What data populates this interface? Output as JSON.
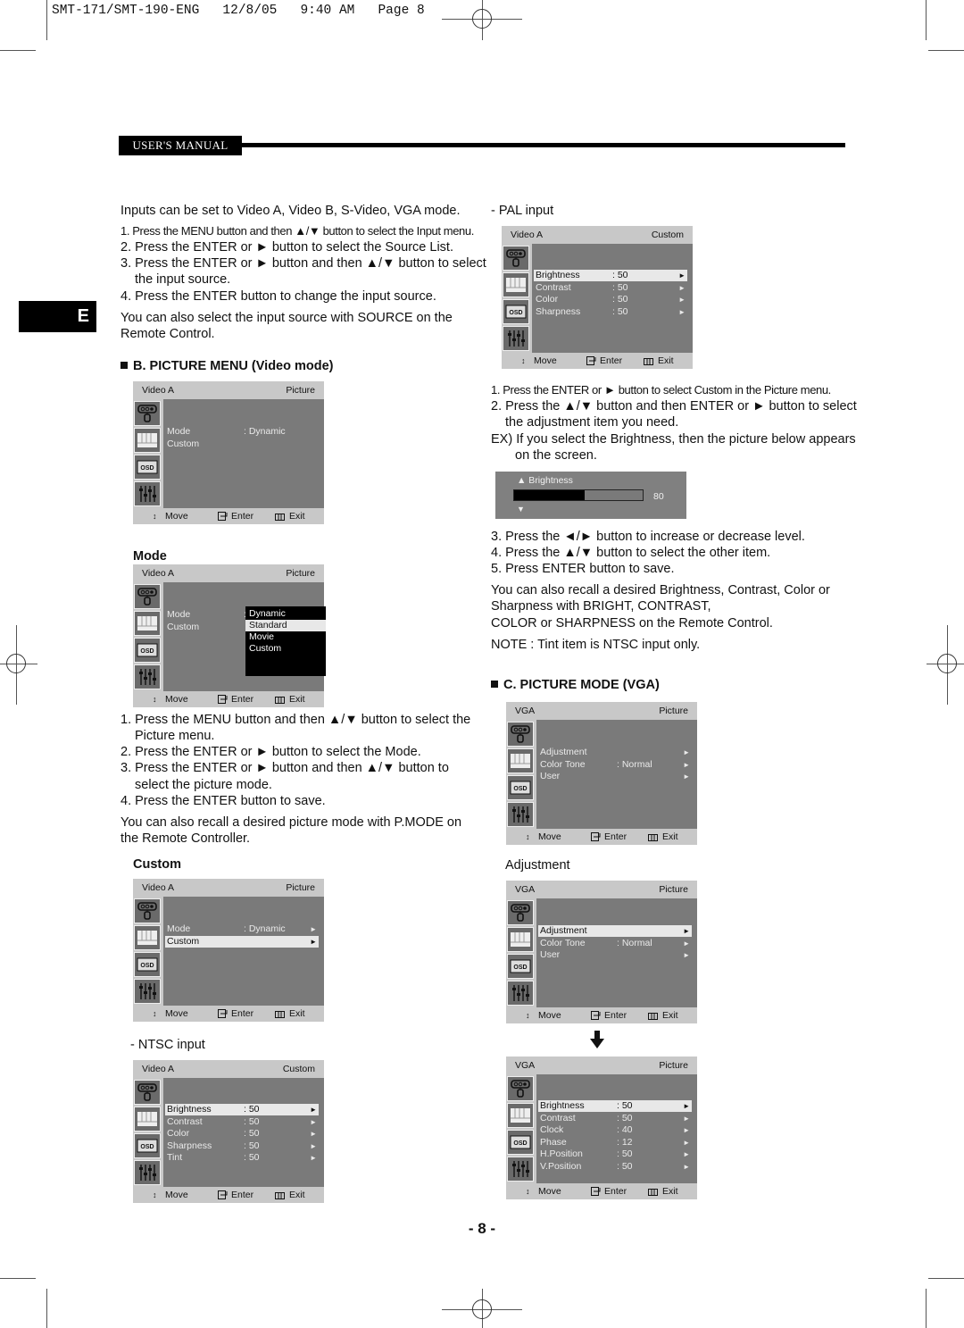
{
  "print_header": "SMT-171/SMT-190-ENG   12/8/05   9:40 AM   Page 8",
  "badge": "USER'S MANUAL",
  "language_tab": "E",
  "page_number": "- 8 -",
  "left": {
    "intro": "Inputs can be set to Video A, Video B, S-Video, VGA mode.",
    "input_steps": [
      "1. Press the MENU button and then ▲/▼ button to select the Input menu.",
      "2. Press the ENTER or ► button to select the Source List.",
      "3. Press the ENTER or ► button and then ▲/▼ button to select",
      "the input source.",
      "4. Press the ENTER button to change the input source."
    ],
    "source_note": [
      "You can also select the input source with SOURCE on the",
      "Remote Control."
    ],
    "section_b": "B. PICTURE MENU (Video mode)",
    "mode_heading": "Mode",
    "mode_steps": [
      "1. Press the MENU button and then ▲/▼ button to select the",
      "Picture menu.",
      "2. Press the ENTER or ► button to select the Mode.",
      "3. Press the ENTER or ► button and then ▲/▼ button to",
      "select the picture mode.",
      "4. Press the ENTER button to save."
    ],
    "pmode_note": [
      "You can also recall a desired picture mode with P.MODE on",
      "the Remote Controller."
    ],
    "custom_heading": "Custom",
    "ntsc_label": "-  NTSC input"
  },
  "right": {
    "pal_label": "- PAL input",
    "custom_steps": [
      "1. Press the ENTER or ► button to select Custom in the Picture menu.",
      "2. Press the ▲/▼ button and then ENTER or ► button to select",
      "the adjustment item you need.",
      "EX) If you select the Brightness, then the picture below appears",
      "on the screen."
    ],
    "brightness_osd": {
      "label": "▲ Brightness",
      "value": "80",
      "level_percent": 80,
      "down": "▼"
    },
    "level_steps": [
      "3. Press the ◄/► button to increase or decrease level.",
      "4. Press the ▲/▼ button to select the other item.",
      "5. Press ENTER button to save."
    ],
    "recall_note": [
      "You can also recall a desired Brightness, Contrast, Color or",
      "Sharpness with BRIGHT, CONTRAST,",
      "COLOR or SHARPNESS on the Remote Control."
    ],
    "tint_note": "NOTE : Tint item is NTSC input only.",
    "section_c": "C. PICTURE MODE (VGA)",
    "adjustment_heading": "Adjustment"
  },
  "osd_footer": {
    "move": "Move",
    "enter": "Enter",
    "exit": "Exit"
  },
  "osd_menus": {
    "picture1": {
      "source": "Video A",
      "title": "Picture",
      "rows": [
        {
          "name": "Mode",
          "value": ": Dynamic",
          "arrow": ""
        },
        {
          "name": "Custom",
          "value": "",
          "arrow": ""
        }
      ]
    },
    "mode": {
      "source": "Video A",
      "title": "Picture",
      "rows": [
        {
          "name": "Mode",
          "value": ":",
          "arrow": ""
        },
        {
          "name": "Custom",
          "value": "",
          "arrow": ""
        }
      ],
      "options": [
        "Dynamic",
        "Standard",
        "Movie",
        "Custom"
      ],
      "highlighted_option": "Standard"
    },
    "custom": {
      "source": "Video A",
      "title": "Picture",
      "rows": [
        {
          "name": "Mode",
          "value": ": Dynamic",
          "arrow": "►"
        },
        {
          "name": "Custom",
          "value": "",
          "arrow": "►"
        }
      ],
      "highlighted": 1
    },
    "ntsc": {
      "source": "Video A",
      "title": "Custom",
      "rows": [
        {
          "name": "Brightness",
          "value": ": 50",
          "arrow": "►"
        },
        {
          "name": "Contrast",
          "value": ": 50",
          "arrow": "►"
        },
        {
          "name": "Color",
          "value": ": 50",
          "arrow": "►"
        },
        {
          "name": "Sharpness",
          "value": ": 50",
          "arrow": "►"
        },
        {
          "name": "Tint",
          "value": ": 50",
          "arrow": "►"
        }
      ],
      "highlighted": 0
    },
    "pal": {
      "source": "Video A",
      "title": "Custom",
      "rows": [
        {
          "name": "Brightness",
          "value": ": 50",
          "arrow": "►"
        },
        {
          "name": "Contrast",
          "value": ": 50",
          "arrow": "►"
        },
        {
          "name": "Color",
          "value": ": 50",
          "arrow": "►"
        },
        {
          "name": "Sharpness",
          "value": ": 50",
          "arrow": "►"
        }
      ],
      "highlighted": 0
    },
    "vga1": {
      "source": "VGA",
      "title": "Picture",
      "rows": [
        {
          "name": "Adjustment",
          "value": "",
          "arrow": "►"
        },
        {
          "name": "Color Tone",
          "value": ": Normal",
          "arrow": "►"
        },
        {
          "name": "User",
          "value": "",
          "arrow": "►"
        }
      ]
    },
    "vga2": {
      "source": "VGA",
      "title": "Picture",
      "rows": [
        {
          "name": "Adjustment",
          "value": "",
          "arrow": "►"
        },
        {
          "name": "Color Tone",
          "value": ": Normal",
          "arrow": "►"
        },
        {
          "name": "User",
          "value": "",
          "arrow": "►"
        }
      ],
      "highlighted": 0
    },
    "vga3": {
      "source": "VGA",
      "title": "Picture",
      "rows": [
        {
          "name": "Brightness",
          "value": ": 50",
          "arrow": "►"
        },
        {
          "name": "Contrast",
          "value": ": 50",
          "arrow": "►"
        },
        {
          "name": "Clock",
          "value": ": 40",
          "arrow": "►"
        },
        {
          "name": "Phase",
          "value": ": 12",
          "arrow": "►"
        },
        {
          "name": "H.Position",
          "value": ": 50",
          "arrow": "►"
        },
        {
          "name": "V.Position",
          "value": ": 50",
          "arrow": "►"
        }
      ],
      "highlighted": 0
    }
  },
  "icons": [
    "input-icon",
    "picture-icon",
    "osd-icon",
    "setup-icon",
    "move-icon",
    "enter-icon",
    "exit-icon",
    "down-arrow-icon"
  ]
}
